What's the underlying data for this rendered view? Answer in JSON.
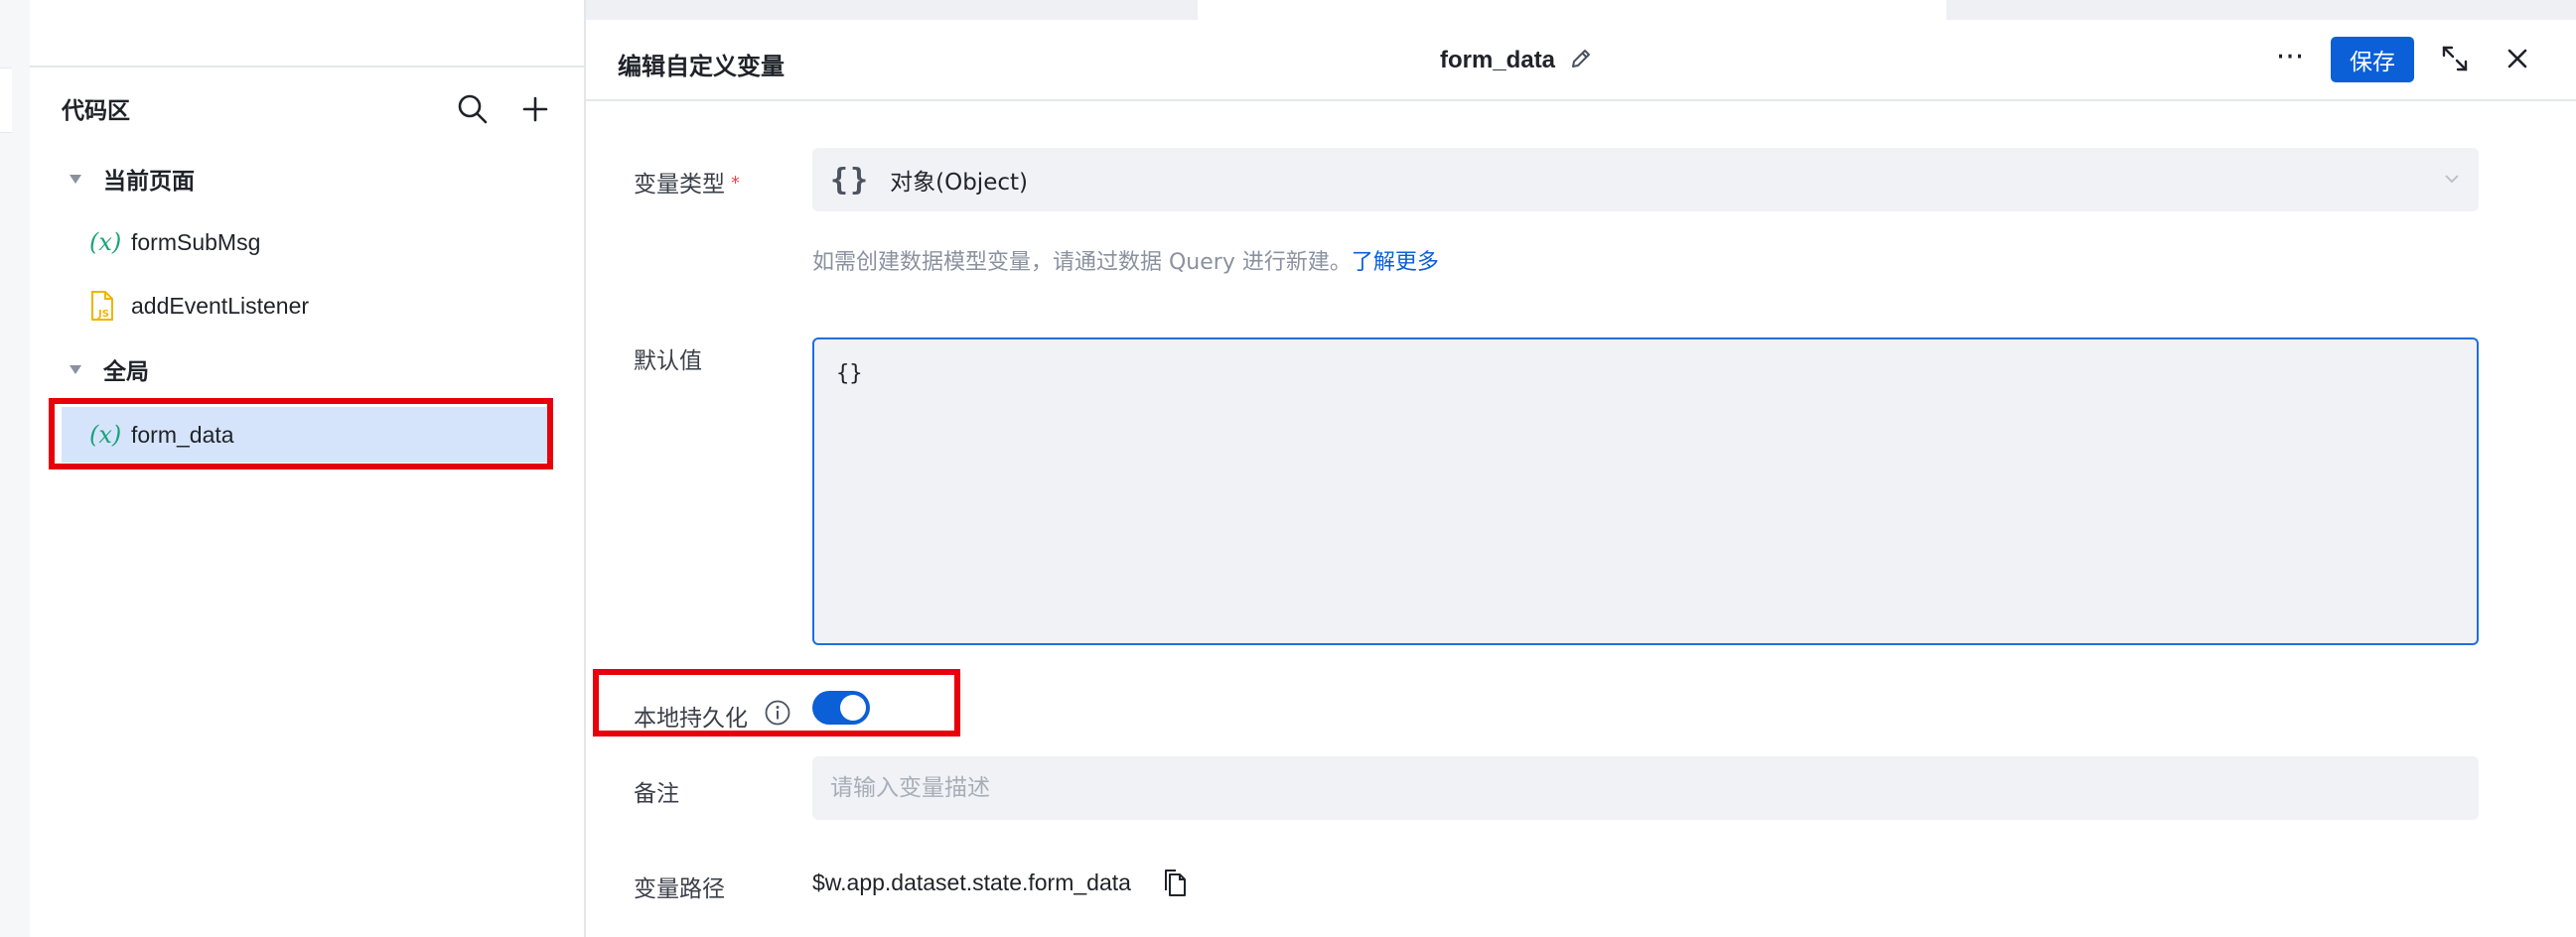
{
  "sidebar": {
    "title": "代码区",
    "groups": [
      {
        "label": "当前页面",
        "items": [
          {
            "glyph": "(x)",
            "label": "formSubMsg",
            "icon": "variable-icon"
          },
          {
            "glyph": "",
            "label": "addEventListener",
            "icon": "js-file-icon"
          }
        ]
      },
      {
        "label": "全局",
        "items": [
          {
            "glyph": "(x)",
            "label": "form_data",
            "icon": "variable-icon",
            "selected": true
          }
        ]
      }
    ]
  },
  "editor": {
    "title": "编辑自定义变量",
    "variable_name": "form_data",
    "more_label": "···",
    "save_label": "保存",
    "close_label": "×",
    "fields": {
      "type": {
        "label": "变量类型",
        "required_mark": "*",
        "braces": "{}",
        "value": "对象(Object)",
        "hint": "如需创建数据模型变量，请通过数据 Query 进行新建。",
        "hint_link": "了解更多"
      },
      "default": {
        "label": "默认值",
        "value": "{}"
      },
      "persist": {
        "label": "本地持久化",
        "enabled": true
      },
      "remark": {
        "label": "备注",
        "placeholder": "请输入变量描述",
        "value": ""
      },
      "path": {
        "label": "变量路径",
        "value": "$w.app.dataset.state.form_data"
      }
    }
  },
  "colors": {
    "accent": "#0b5fd7",
    "highlight": "#e8000b",
    "selected_bg": "#d6e4fb",
    "variable_glyph": "#1aa37a",
    "js_icon": "#f0b400"
  }
}
